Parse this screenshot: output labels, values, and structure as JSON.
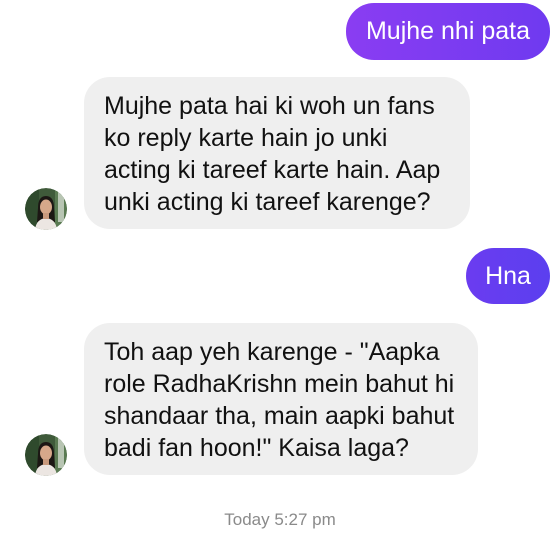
{
  "messages": [
    {
      "direction": "outgoing",
      "lines": [
        "Mujhe nhi pata"
      ]
    },
    {
      "direction": "incoming",
      "lines": [
        "Mujhe pata hai ki woh un fans",
        "ko reply karte hain jo unki",
        "acting ki tareef karte hain. Aap",
        "unki acting ki tareef karenge?"
      ]
    },
    {
      "direction": "outgoing",
      "lines": [
        "Hna"
      ]
    },
    {
      "direction": "incoming",
      "lines": [
        "Toh aap yeh karenge - \"Aapka",
        "role RadhaKrishn mein bahut hi",
        "shandaar tha, main aapki bahut",
        "badi fan hoon!\" Kaisa laga?"
      ]
    }
  ],
  "timestamp": "Today 5:27 pm",
  "colors": {
    "outgoing_bubble": "#7a3cf1",
    "incoming_bubble": "#efefef",
    "timestamp_text": "#8a8a8a"
  },
  "icons": {
    "avatar": "profile-photo-avatar"
  }
}
